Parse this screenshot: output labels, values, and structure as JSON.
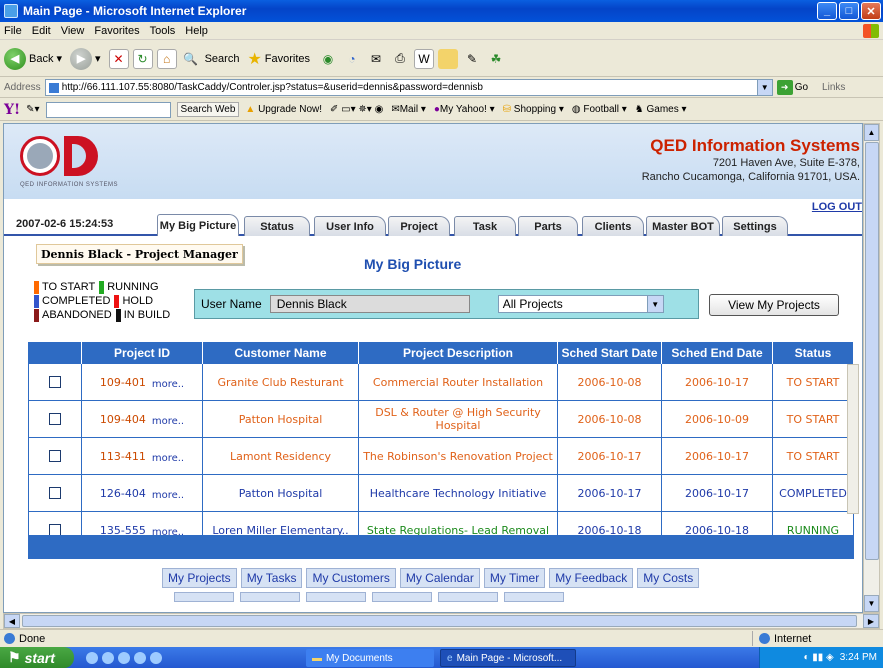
{
  "window": {
    "title": "Main Page - Microsoft Internet Explorer"
  },
  "menu": [
    "File",
    "Edit",
    "View",
    "Favorites",
    "Tools",
    "Help"
  ],
  "toolbar": {
    "back": "Back",
    "search": "Search",
    "favorites": "Favorites"
  },
  "address": {
    "label": "Address",
    "url": "http://66.111.107.55:8080/TaskCaddy/Controler.jsp?status=&userid=dennis&password=dennisb",
    "go": "Go",
    "links": "Links"
  },
  "yahoo": {
    "search_web": "Search Web",
    "upgrade": "Upgrade Now!",
    "mail": "Mail",
    "my_yahoo": "My Yahoo!",
    "shopping": "Shopping",
    "football": "Football",
    "games": "Games"
  },
  "company": {
    "name": "QED Information Systems",
    "addr1": "7201 Haven Ave, Suite E-378,",
    "addr2": "Rancho Cucamonga, California 91701, USA.",
    "logo_text": "QED INFORMATION SYSTEMS"
  },
  "header": {
    "logout": "LOG OUT",
    "datetime": "2007-02-6   15:24:53"
  },
  "tabs": [
    "My Big Picture",
    "Status",
    "User Info",
    "Project",
    "Task",
    "Parts",
    "Clients",
    "Master BOT",
    "Settings"
  ],
  "page": {
    "role": "Dennis Black - Project Manager",
    "title": "My Big Picture"
  },
  "legend": {
    "to_start": "TO START",
    "running": "RUNNING",
    "completed": "COMPLETED",
    "hold": "HOLD",
    "abandoned": "ABANDONED",
    "in_build": "IN BUILD",
    "colors": {
      "to_start": "#ff6a00",
      "running": "#22aa22",
      "completed": "#3355cc",
      "hold": "#ee1111",
      "abandoned": "#8b1a1a",
      "in_build": "#111111"
    }
  },
  "filter": {
    "username_label": "User Name",
    "username_value": "Dennis  Black",
    "project_select": "All Projects",
    "view_button": "View My Projects"
  },
  "table": {
    "headers": [
      "Project ID",
      "Customer Name",
      "Project Description",
      "Sched Start Date",
      "Sched End Date",
      "Status"
    ],
    "more": "more..",
    "rows": [
      {
        "id": "109-401",
        "customer": "Granite Club Resturant",
        "desc": "Commercial Router Installation",
        "start": "2006-10-08",
        "end": "2006-10-17",
        "status": "TO START",
        "tone": "orange"
      },
      {
        "id": "109-404",
        "customer": "Patton Hospital",
        "desc": "DSL & Router @ High Security Hospital",
        "start": "2006-10-08",
        "end": "2006-10-09",
        "status": "TO START",
        "tone": "orange"
      },
      {
        "id": "113-411",
        "customer": "Lamont Residency",
        "desc": "The Robinson's Renovation Project",
        "start": "2006-10-17",
        "end": "2006-10-17",
        "status": "TO START",
        "tone": "orange"
      },
      {
        "id": "126-404",
        "customer": "Patton Hospital",
        "desc": "Healthcare Technology Initiative",
        "start": "2006-10-17",
        "end": "2006-10-17",
        "status": "COMPLETED",
        "tone": "blue"
      },
      {
        "id": "135-555",
        "customer": "Loren Miller Elementary..",
        "desc": "State Regulations- Lead Removal",
        "start": "2006-10-18",
        "end": "2006-10-18",
        "status": "RUNNING",
        "tone": "green"
      }
    ]
  },
  "footer_links": [
    "My Projects",
    "My Tasks",
    "My Customers",
    "My Calendar",
    "My Timer",
    "My Feedback",
    "My Costs"
  ],
  "status_bar": {
    "text": "Done",
    "zone": "Internet"
  },
  "taskbar": {
    "start": "start",
    "task1": "My Documents",
    "task2": "Main Page - Microsoft...",
    "time": "3:24 PM"
  }
}
